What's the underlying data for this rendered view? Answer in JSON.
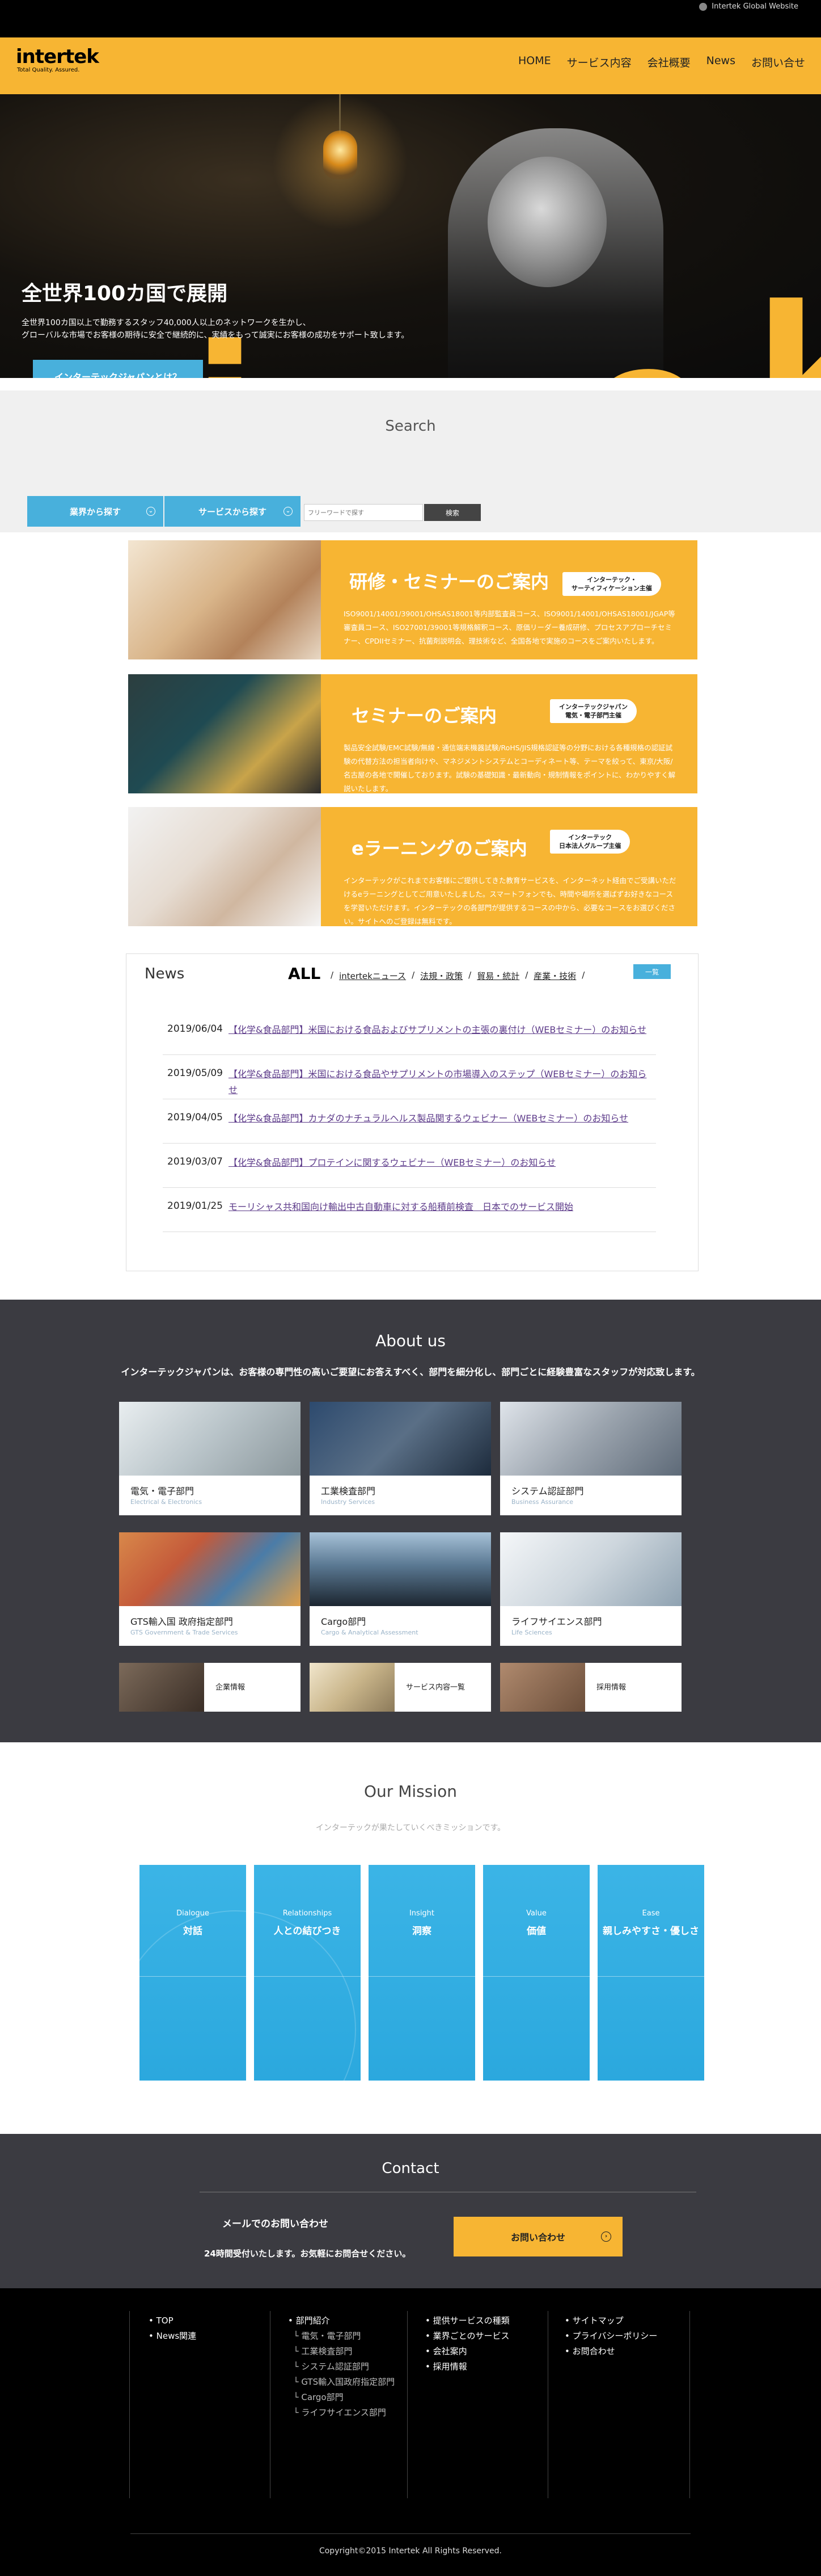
{
  "topbar": {
    "global_link": "Intertek Global Website"
  },
  "header": {
    "logo_text": "intertek",
    "logo_tagline": "Total Quality. Assured.",
    "nav": [
      "HOME",
      "サービス内容",
      "会社概要",
      "News",
      "お問い合せ"
    ]
  },
  "hero": {
    "title": "全世界100カ国で展開",
    "subtitle_line1": "全世界100カ国以上で勤務するスタッフ40,000人以上のネットワークを生かし、",
    "subtitle_line2": "グローバルな市場でお客様の期待に安全で継続的に、実績をもって誠実にお客様の成功をサポート致します。",
    "button": "インターテックジャパンとは？",
    "big_letters": "iek"
  },
  "search": {
    "title": "Search",
    "by_industry": "業界から探す",
    "by_service": "サービスから探す",
    "placeholder": "フリーワードで探す",
    "submit": "検索"
  },
  "cards": [
    {
      "title": "研修・セミナーのご案内",
      "tag": "インターテック・\nサーティフィケーション主催",
      "desc": "ISO9001/14001/39001/OHSAS18001等内部監査員コース、ISO9001/14001/OHSAS18001/JGAP等審査員コース、ISO27001/39001等規格解釈コース、原価リーダー養成研修、プロセスアプローチセミナー、CPDIIセミナー、抗菌剤説明会、理技術など、全国各地で実施のコースをご案内いたします。"
    },
    {
      "title": "セミナーのご案内",
      "tag": "インターテックジャパン\n電気・電子部門主催",
      "desc": "製品安全試験/EMC試験/無線・通信端末機器試験/RoHS/JIS規格認証等の分野における各種規格の認証試験の代替方法の担当者向けや、マネジメントシステムとコーディネート等、テーマを絞って、東京/大阪/名古屋の各地で開催しております。試験の基礎知識・最新動向・規制情報をポイントに、わかりやすく解説いたします。"
    },
    {
      "title": "eラーニングのご案内",
      "tag": "インターテック\n日本法人グループ主催",
      "desc": "インターテックがこれまでお客様にご提供してきた教育サービスを、インターネット経由でご受講いただけるeラーニングとしてご用意いたしました。スマートフォンでも、時間や場所を選ばずお好きなコースを学習いただけます。インターテックの各部門が提供するコースの中から、必要なコースをお選びください。サイトへのご登録は無料です。"
    }
  ],
  "news": {
    "heading": "News",
    "all_label": "ALL",
    "tabs": [
      "intertekニュース",
      "法規・政策",
      "貿易・統計",
      "産業・技術"
    ],
    "list_button": "一覧",
    "items": [
      {
        "date": "2019/06/04",
        "title": "【化学&食品部門】米国における食品およびサプリメントの主張の裏付け（WEBセミナー）のお知らせ"
      },
      {
        "date": "2019/05/09",
        "title": "【化学&食品部門】米国における食品やサプリメントの市場導入のステップ（WEBセミナー）のお知らせ"
      },
      {
        "date": "2019/04/05",
        "title": "【化学&食品部門】カナダのナチュラルヘルス製品関するウェビナー（WEBセミナー）のお知らせ"
      },
      {
        "date": "2019/03/07",
        "title": "【化学&食品部門】プロテインに関するウェビナー（WEBセミナー）のお知らせ"
      },
      {
        "date": "2019/01/25",
        "title": "モーリシャス共和国向け輸出中古自動車に対する船積前検査　日本でのサービス開始"
      }
    ]
  },
  "about": {
    "heading": "About us",
    "subtitle": "インターテックジャパンは、お客様の専門性の高いご要望にお答えすべく、部門を細分化し、部門ごとに経験豊富なスタッフが対応致します。",
    "tiles": [
      {
        "name": "電気・電子部門",
        "en": "Electrical & Electronics"
      },
      {
        "name": "工業検査部門",
        "en": "Industry Services"
      },
      {
        "name": "システム認証部門",
        "en": "Business Assurance"
      },
      {
        "name": "GTS輸入国 政府指定部門",
        "en": "GTS Government & Trade Services"
      },
      {
        "name": "Cargo部門",
        "en": "Cargo & Analytical Assessment"
      },
      {
        "name": "ライフサイエンス部門",
        "en": "Life Sciences"
      }
    ],
    "minis": [
      "企業情報",
      "サービス内容一覧",
      "採用情報"
    ]
  },
  "mission": {
    "heading": "Our Mission",
    "subtitle": "インターテックが果たしていくべきミッションです。",
    "items": [
      {
        "en": "Dialogue",
        "jp": "対話"
      },
      {
        "en": "Relationships",
        "jp": "人との結びつき"
      },
      {
        "en": "Insight",
        "jp": "洞察"
      },
      {
        "en": "Value",
        "jp": "価値"
      },
      {
        "en": "Ease",
        "jp": "親しみやすさ・優しさ"
      }
    ]
  },
  "contact": {
    "heading": "Contact",
    "line1": "メールでのお問い合わせ",
    "line2": "24時間受付いたします。お気軽にお問合せください。",
    "button": "お問い合わせ"
  },
  "footer": {
    "col1": [
      "TOP",
      "News関連"
    ],
    "col2_head": "部門紹介",
    "col2": [
      "電気・電子部門",
      "工業検査部門",
      "システム認証部門",
      "GTS輸入国政府指定部門",
      "Cargo部門",
      "ライフサイエンス部門"
    ],
    "col3": [
      "提供サービスの種類",
      "業界ごとのサービス",
      "会社案内",
      "採用情報"
    ],
    "col4": [
      "サイトマップ",
      "プライバシーポリシー",
      "お問合わせ"
    ],
    "copyright": "Copyright©2015 Intertek All Rights Reserved."
  },
  "colors": {
    "brand_yellow": "#f7b533",
    "accent_blue": "#48b0dc",
    "dark": "#3b3b41"
  }
}
